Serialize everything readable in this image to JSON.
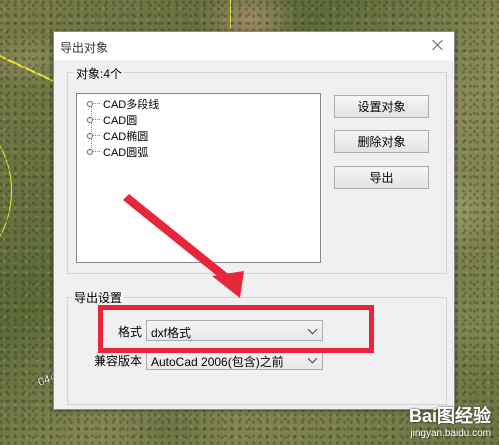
{
  "dialog": {
    "title": "导出对象",
    "objects_group_label": "对象:4个",
    "objects": [
      {
        "label": "CAD多段线"
      },
      {
        "label": "CAD圆"
      },
      {
        "label": "CAD椭圆"
      },
      {
        "label": "CAD圆弧"
      }
    ],
    "buttons": {
      "set_objects": "设置对象",
      "delete_objects": "删除对象",
      "export": "导出"
    },
    "export_settings": {
      "group_label": "导出设置",
      "format_label": "格式",
      "format_value": "dxf格式",
      "compat_label": "兼容版本",
      "compat_value": "AutoCad 2006(包含)之前"
    }
  },
  "map": {
    "road_label": "044"
  },
  "watermark": {
    "brand": "Bai图经验",
    "url": "jingyan.baidu.com"
  },
  "colors": {
    "highlight": "#e8263a",
    "boundary": "#e8e83a"
  }
}
